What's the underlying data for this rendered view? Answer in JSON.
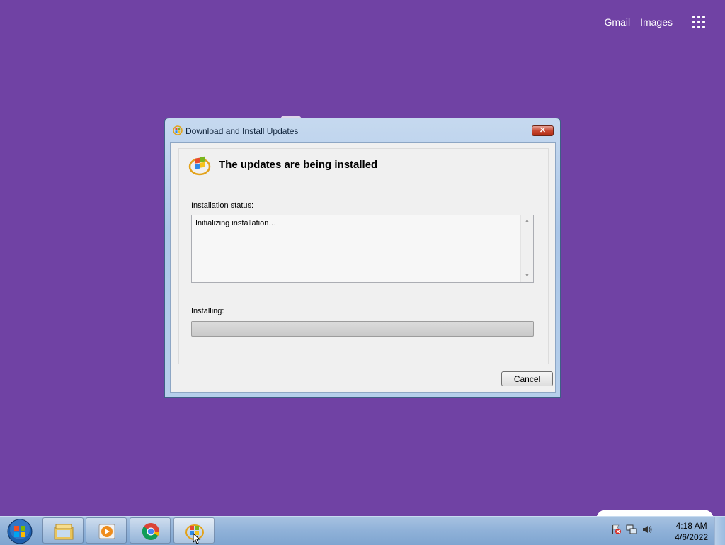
{
  "google_links": {
    "gmail": "Gmail",
    "images": "Images",
    "apps_icon": "apps-grid-icon"
  },
  "dialog": {
    "title": "Download and Install Updates",
    "heading": "The updates are being installed",
    "status_label": "Installation status:",
    "status_text": "Initializing installation…",
    "progress_label": "Installing:",
    "progress_value": 0,
    "cancel_label": "Cancel",
    "close_glyph": "✕"
  },
  "taskbar": {
    "items": [
      "start-orb-icon",
      "file-explorer-icon",
      "media-player-icon",
      "chrome-icon",
      "windows-update-icon"
    ],
    "tray_icons": [
      "action-center-icon",
      "network-icon",
      "volume-icon"
    ],
    "time": "4:18 AM",
    "date": "4/6/2022"
  },
  "colors": {
    "desktop": "#7042a4",
    "taskbar": "#8fb1d8",
    "dialog_frame": "#aac6e8"
  }
}
